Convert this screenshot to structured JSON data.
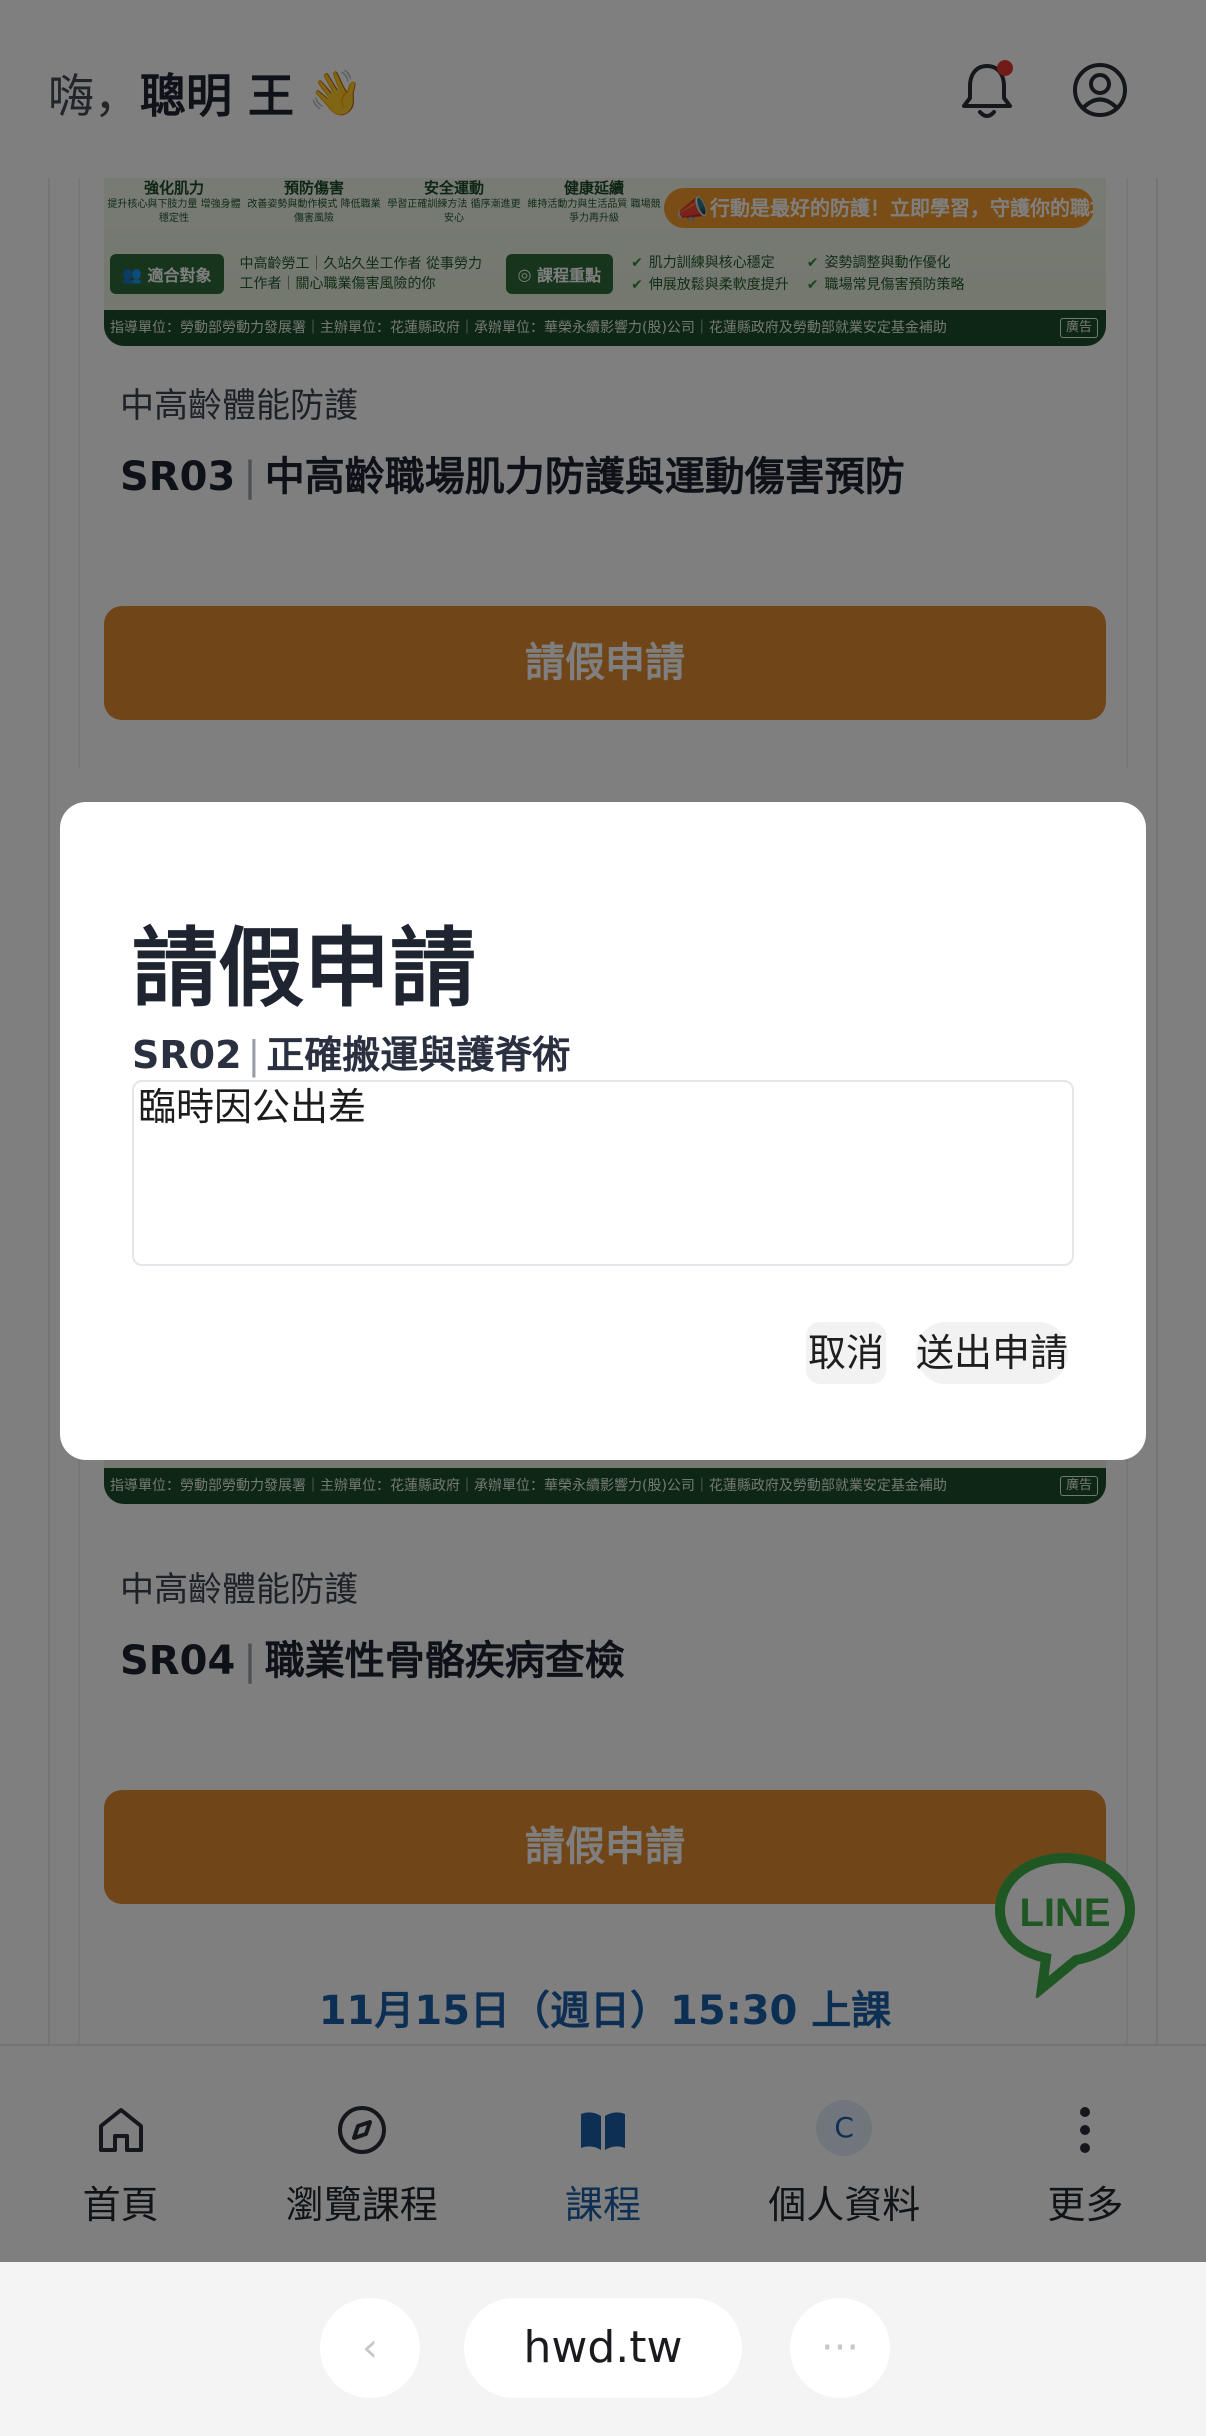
{
  "header": {
    "greeting": "嗨，",
    "user_name": "聰明 王",
    "wave": "👋"
  },
  "card1": {
    "banner": {
      "features": [
        {
          "title": "強化肌力",
          "desc": "提升核心與下肢力量 增強身體穩定性"
        },
        {
          "title": "預防傷害",
          "desc": "改善姿勢與動作模式 降低職業傷害風險"
        },
        {
          "title": "安全運動",
          "desc": "學習正確訓練方法 循序漸進更安心"
        },
        {
          "title": "健康延續",
          "desc": "維持活動力與生活品質 職場競爭力再升級"
        }
      ],
      "cta": "行動是最好的防護！立即學習，守護你的職場力！",
      "audience_label": "適合對象",
      "audience_text": "中高齡勞工｜久站久坐工作者 從事勞力工作者｜關心職業傷害風險的你",
      "focus_label": "課程重點",
      "focus_points": [
        "肌力訓練與核心穩定",
        "伸展放鬆與柔軟度提升",
        "姿勢調整與動作優化",
        "職場常見傷害預防策略"
      ],
      "footer": "指導單位：勞動部勞動力發展署｜主辦單位：花蓮縣政府｜承辦單位：華榮永續影響力(股)公司｜花蓮縣政府及勞動部就業安定基金補助",
      "ad_tag": "廣告"
    },
    "category": "中高齡體能防護",
    "code": "SR03",
    "title": "中高齡職場肌力防護與運動傷害預防",
    "button": "請假申請"
  },
  "card2": {
    "banner": {
      "footer": "指導單位：勞動部勞動力發展署｜主辦單位：花蓮縣政府｜承辦單位：華榮永續影響力(股)公司｜花蓮縣政府及勞動部就業安定基金補助",
      "ad_tag": "廣告"
    },
    "category": "中高齡體能防護",
    "code": "SR04",
    "title": "職業性骨骼疾病查檢",
    "button": "請假申請",
    "schedule": "11月15日（週日）15:30 上課"
  },
  "line_fab": {
    "label": "LINE"
  },
  "bottom_nav": {
    "items": [
      {
        "label": "首頁",
        "icon": "home-icon"
      },
      {
        "label": "瀏覽課程",
        "icon": "compass-icon"
      },
      {
        "label": "課程",
        "icon": "book-icon"
      },
      {
        "label": "個人資料",
        "icon": "avatar-icon",
        "initial": "C"
      },
      {
        "label": "更多",
        "icon": "more-vertical-icon"
      }
    ],
    "active": "課程"
  },
  "browser": {
    "url": "hwd.tw"
  },
  "modal": {
    "title": "請假申請",
    "course_code": "SR02",
    "course_title": "正確搬運與護脊術",
    "reason_value": "臨時因公出差",
    "cancel_label": "取消",
    "submit_label": "送出申請"
  },
  "colors": {
    "accent_orange": "#e08a2e",
    "brand_blue": "#1c5fa8",
    "banner_green": "#1d4d28",
    "line_green": "#3fae49"
  }
}
